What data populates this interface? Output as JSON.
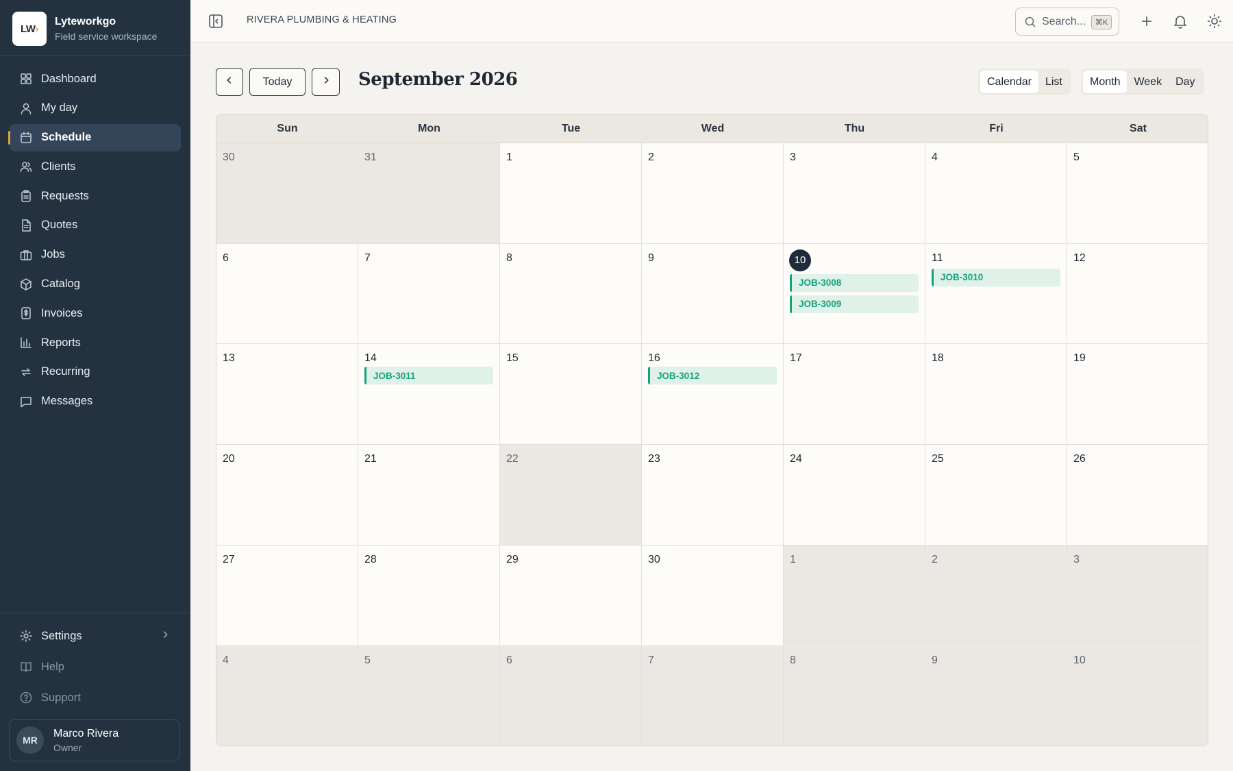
{
  "brand": {
    "logo_text": "LW",
    "name": "Lyteworkgo",
    "subtitle": "Field service workspace"
  },
  "sidebar": {
    "items": [
      {
        "label": "Dashboard",
        "icon": "dashboard-icon"
      },
      {
        "label": "My day",
        "icon": "user-icon"
      },
      {
        "label": "Schedule",
        "icon": "calendar-icon",
        "active": true
      },
      {
        "label": "Clients",
        "icon": "users-icon"
      },
      {
        "label": "Requests",
        "icon": "clipboard-icon"
      },
      {
        "label": "Quotes",
        "icon": "document-icon"
      },
      {
        "label": "Jobs",
        "icon": "briefcase-icon"
      },
      {
        "label": "Catalog",
        "icon": "box-icon"
      },
      {
        "label": "Invoices",
        "icon": "invoice-icon"
      },
      {
        "label": "Reports",
        "icon": "bar-chart-icon"
      },
      {
        "label": "Recurring",
        "icon": "repeat-icon"
      },
      {
        "label": "Messages",
        "icon": "message-icon"
      }
    ],
    "bottom": [
      {
        "label": "Settings",
        "icon": "gear-icon"
      },
      {
        "label": "Help",
        "icon": "book-icon"
      },
      {
        "label": "Support",
        "icon": "help-circle-icon"
      }
    ],
    "user": {
      "initials": "MR",
      "name": "Marco Rivera",
      "role": "Owner"
    }
  },
  "topbar": {
    "company": "RIVERA PLUMBING & HEATING",
    "search_placeholder": "Search...",
    "search_shortcut": "⌘K"
  },
  "calendar": {
    "today_label": "Today",
    "title": "September 2026",
    "view_toggle": [
      "Calendar",
      "List"
    ],
    "view_active": "Calendar",
    "range_toggle": [
      "Month",
      "Week",
      "Day"
    ],
    "range_active": "Month",
    "weekdays": [
      "Sun",
      "Mon",
      "Tue",
      "Wed",
      "Thu",
      "Fri",
      "Sat"
    ],
    "weeks": [
      [
        {
          "day": "30",
          "out": true
        },
        {
          "day": "31",
          "out": true
        },
        {
          "day": "1"
        },
        {
          "day": "2"
        },
        {
          "day": "3"
        },
        {
          "day": "4"
        },
        {
          "day": "5"
        }
      ],
      [
        {
          "day": "6"
        },
        {
          "day": "7"
        },
        {
          "day": "8"
        },
        {
          "day": "9"
        },
        {
          "day": "10",
          "today": true,
          "jobs": [
            "JOB-3008",
            "JOB-3009"
          ]
        },
        {
          "day": "11",
          "jobs": [
            "JOB-3010"
          ]
        },
        {
          "day": "12"
        }
      ],
      [
        {
          "day": "13"
        },
        {
          "day": "14",
          "jobs": [
            "JOB-3011"
          ]
        },
        {
          "day": "15"
        },
        {
          "day": "16",
          "jobs": [
            "JOB-3012"
          ]
        },
        {
          "day": "17"
        },
        {
          "day": "18"
        },
        {
          "day": "19"
        }
      ],
      [
        {
          "day": "20"
        },
        {
          "day": "21"
        },
        {
          "day": "22",
          "out": true
        },
        {
          "day": "23"
        },
        {
          "day": "24"
        },
        {
          "day": "25"
        },
        {
          "day": "26"
        }
      ],
      [
        {
          "day": "27"
        },
        {
          "day": "28"
        },
        {
          "day": "29"
        },
        {
          "day": "30"
        },
        {
          "day": "1",
          "out": true
        },
        {
          "day": "2",
          "out": true
        },
        {
          "day": "3",
          "out": true
        }
      ],
      [
        {
          "day": "4",
          "out": true
        },
        {
          "day": "5",
          "out": true
        },
        {
          "day": "6",
          "out": true
        },
        {
          "day": "7",
          "out": true
        },
        {
          "day": "8",
          "out": true
        },
        {
          "day": "9",
          "out": true
        },
        {
          "day": "10",
          "out": true
        }
      ]
    ]
  },
  "colors": {
    "sidebar_bg": "#243240",
    "accent": "#e2a13b",
    "job_green": "#13a37c",
    "today_bg": "#1f2b3a"
  }
}
